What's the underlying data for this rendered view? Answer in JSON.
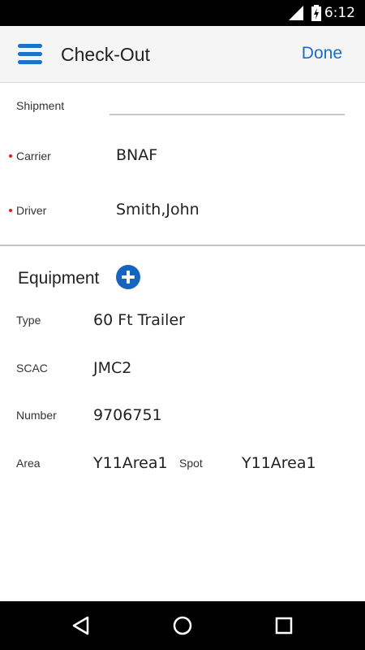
{
  "status_bar": {
    "time": "6:12",
    "icons": [
      "signal-icon",
      "battery-charging-icon"
    ]
  },
  "app_bar": {
    "menu_icon": "hamburger-menu-icon",
    "title": "Check-Out",
    "done_label": "Done"
  },
  "form": {
    "shipment": {
      "label": "Shipment",
      "value": "",
      "placeholder": ""
    },
    "carrier": {
      "label": "Carrier",
      "value": "BNAF",
      "required": true
    },
    "driver": {
      "label": "Driver",
      "value": "Smith,John",
      "required": true
    }
  },
  "equipment": {
    "title": "Equipment",
    "add_icon": "add-circle-icon",
    "type": {
      "label": "Type",
      "value": "60 Ft Trailer"
    },
    "scac": {
      "label": "SCAC",
      "value": "JMC2"
    },
    "number": {
      "label": "Number",
      "value": "9706751"
    },
    "area": {
      "label": "Area",
      "value": "Y11Area1"
    },
    "spot": {
      "label": "Spot",
      "value": "Y11Area1"
    }
  },
  "colors": {
    "accent": "#1a6fc4",
    "required": "#e01b1b",
    "app_bar_bg": "#f5f5f5"
  },
  "nav_bar": {
    "icons": [
      "back-icon",
      "home-icon",
      "recents-icon"
    ]
  }
}
